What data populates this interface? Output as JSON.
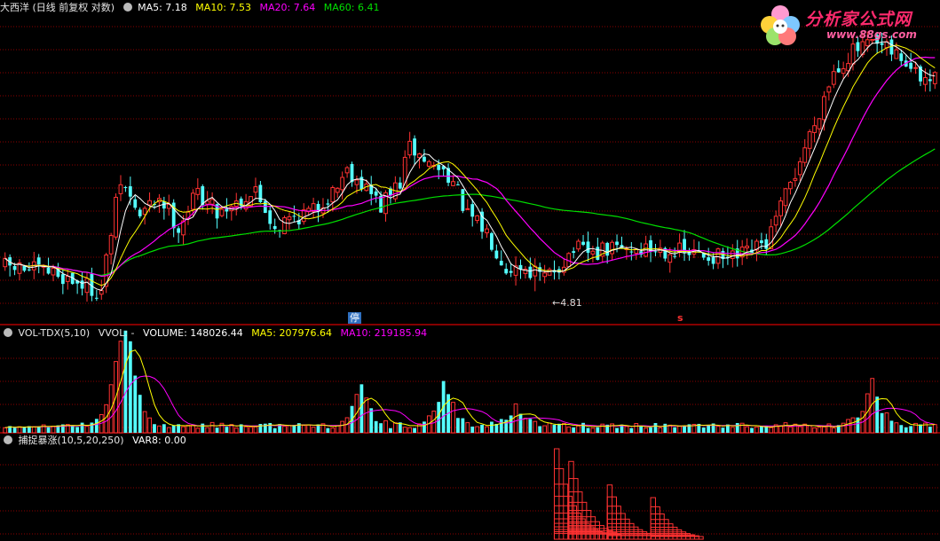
{
  "main_header": {
    "title": "大西洋 (日线 前复权 对数)",
    "ma5": "MA5: 7.18",
    "ma10": "MA10: 7.53",
    "ma20": "MA20: 7.64",
    "ma60": "MA60: 6.41"
  },
  "vol_header": {
    "title": "VOL-TDX(5,10)",
    "vvol": "VVOL: -",
    "volume": "VOLUME: 148026.44",
    "ma5": "MA5: 207976.64",
    "ma10": "MA10: 219185.94"
  },
  "ind_header": {
    "title": "捕捉暴涨(10,5,20,250)",
    "var8": "VAR8: 0.00"
  },
  "logo": {
    "title": "分析家公式网",
    "url": "www.88gs.com"
  },
  "annotations": {
    "low_label": "4.81",
    "mark_a": "停",
    "mark_b": "s"
  },
  "colors": {
    "up": "#ff3232",
    "down": "#54ffff",
    "ma5": "#ffffff",
    "ma10": "#ffff00",
    "ma20": "#ff00ff",
    "ma60": "#00e000",
    "grid": "#8b0000",
    "separator": "#b00000"
  },
  "chart_data": [
    {
      "type": "candlestick",
      "title": "大西洋 (日线 前复权 对数)",
      "scale": "log",
      "lowest_marked_price": 4.81,
      "close_path": [
        [
          0,
          5.2
        ],
        [
          10,
          5.1
        ],
        [
          20,
          4.8
        ],
        [
          24,
          6.8
        ],
        [
          28,
          6.1
        ],
        [
          32,
          6.5
        ],
        [
          36,
          5.9
        ],
        [
          40,
          6.6
        ],
        [
          44,
          6.2
        ],
        [
          48,
          6.4
        ],
        [
          52,
          6.6
        ],
        [
          56,
          5.9
        ],
        [
          60,
          6.1
        ],
        [
          64,
          6.2
        ],
        [
          68,
          6.6
        ],
        [
          71,
          7.1
        ],
        [
          74,
          6.8
        ],
        [
          78,
          6.3
        ],
        [
          82,
          6.8
        ],
        [
          84,
          7.6
        ],
        [
          88,
          7.2
        ],
        [
          92,
          7.0
        ],
        [
          96,
          6.1
        ],
        [
          100,
          5.8
        ],
        [
          104,
          5.2
        ],
        [
          108,
          5.2
        ],
        [
          112,
          5.0
        ],
        [
          116,
          5.3
        ],
        [
          118,
          5.5
        ],
        [
          122,
          5.4
        ],
        [
          126,
          5.5
        ],
        [
          130,
          5.5
        ],
        [
          134,
          5.5
        ],
        [
          138,
          5.5
        ],
        [
          142,
          5.4
        ],
        [
          146,
          5.4
        ],
        [
          150,
          5.3
        ],
        [
          154,
          5.4
        ],
        [
          158,
          5.6
        ],
        [
          160,
          6.0
        ],
        [
          164,
          7.0
        ],
        [
          168,
          8.2
        ],
        [
          172,
          9.7
        ],
        [
          176,
          10.3
        ],
        [
          180,
          10.5
        ],
        [
          182,
          10.4
        ],
        [
          186,
          10.1
        ],
        [
          190,
          9.4
        ]
      ],
      "ma_final": {
        "MA5": 7.18,
        "MA10": 7.53,
        "MA20": 7.64,
        "MA60": 6.41
      }
    },
    {
      "type": "bar",
      "title": "VOL-TDX(5,10)",
      "series_final": {
        "VOLUME": 148026.44,
        "MA5": 207976.64,
        "MA10": 219185.94
      },
      "peaks": [
        [
          24,
          600000
        ],
        [
          26,
          480000
        ],
        [
          74,
          320000
        ],
        [
          91,
          380000
        ],
        [
          106,
          150000
        ],
        [
          180,
          330000
        ]
      ]
    },
    {
      "type": "bar",
      "title": "捕捉暴涨(10,5,20,250)",
      "final": {
        "VAR8": 0.0
      },
      "peaks": [
        [
          115,
          1.0
        ],
        [
          118,
          0.86
        ],
        [
          126,
          0.6
        ],
        [
          135,
          0.46
        ]
      ]
    }
  ]
}
